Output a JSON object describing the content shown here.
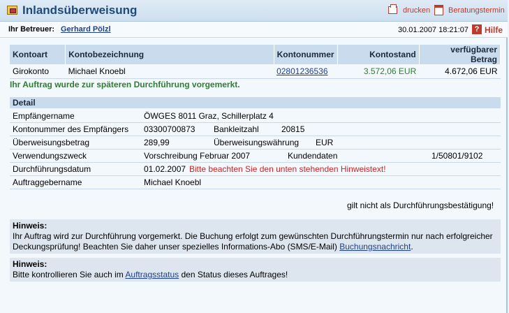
{
  "header": {
    "title": "Inlandsüberweisung",
    "print_label": "drucken",
    "appointment_label": "Beratungstermin"
  },
  "advisor": {
    "label": "Ihr Betreuer:",
    "name": "Gerhard Pölzl",
    "datetime": "30.01.2007 18:21:07",
    "help_label": "Hilfe"
  },
  "account_table": {
    "columns": [
      "Kontoart",
      "Kontobezeichnung",
      "Kontonummer",
      "Kontostand",
      "verfügbarer Betrag"
    ],
    "row": {
      "type": "Girokonto",
      "name": "Michael Knoebl",
      "number": "02801236536",
      "balance": "3.572,06 EUR",
      "available": "4.672,06 EUR"
    }
  },
  "success_message": "Ihr Auftrag wurde zur späteren Durchführung vorgemerkt.",
  "detail": {
    "heading": "Detail",
    "recipient_label": "Empfängername",
    "recipient_value": "ÖWGES 8011 Graz, Schillerplatz 4",
    "account_label": "Kontonummer des Empfängers",
    "account_value": "03300700873",
    "bank_code_label": "Bankleitzahl",
    "bank_code_value": "20815",
    "amount_label": "Überweisungsbetrag",
    "amount_value": "289,99",
    "currency_label": "Überweisungswährung",
    "currency_value": "EUR",
    "purpose_label": "Verwendungszweck",
    "purpose_value": "Vorschreibung Februar 2007",
    "customer_data_label": "Kundendaten",
    "customer_data_value": "1/50801/9102",
    "execution_label": "Durchführungsdatum",
    "execution_value": "01.02.2007",
    "execution_warning": "Bitte beachten Sie den unten stehenden Hinweistext!",
    "orderer_label": "Auftraggebername",
    "orderer_value": "Michael Knoebl"
  },
  "confirmation_note": "gilt nicht als Durchführungsbestätigung!",
  "hint1": {
    "title": "Hinweis:",
    "text_before": "Ihr Auftrag wird zur Durchführung vorgemerkt. Die Buchung erfolgt zum gewünschten Durchführungstermin nur nach erfolgreicher Deckungsprüfung! Beachten Sie daher unser spezielles Informations-Abo (SMS/E-Mail) ",
    "link": "Buchungsnachricht",
    "text_after": "."
  },
  "hint2": {
    "title": "Hinweis:",
    "text_before": "Bitte kontrollieren Sie auch im ",
    "link": "Auftragsstatus",
    "text_after": " den Status dieses Auftrages!"
  },
  "colors": {
    "accent": "#1e4b78",
    "success": "#2e7d32",
    "warning": "#d32222",
    "header_bg": "#c9dcee"
  }
}
